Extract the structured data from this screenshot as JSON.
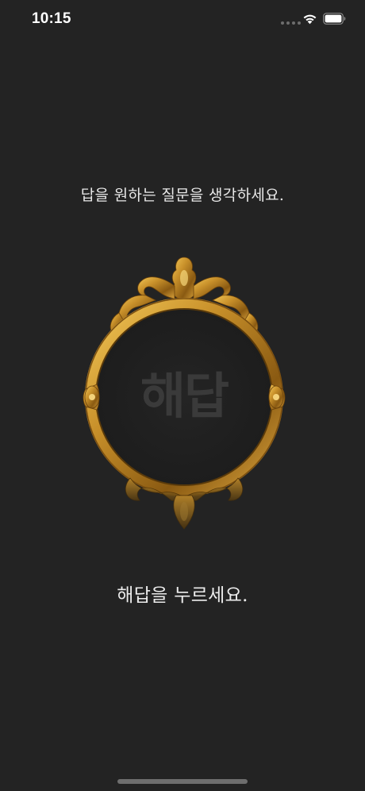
{
  "status_bar": {
    "time": "10:15",
    "icons": [
      "cellular-signal-icon",
      "wifi-icon",
      "battery-icon"
    ]
  },
  "prompt": {
    "text": "답을 원하는 질문을 생각하세요."
  },
  "mirror": {
    "label": "해답",
    "frame_color": "#c8902a"
  },
  "instruction": {
    "text": "해답을 누르세요."
  },
  "colors": {
    "background": "#232323",
    "text": "#e9e9e9",
    "gold": "#c8902a"
  }
}
